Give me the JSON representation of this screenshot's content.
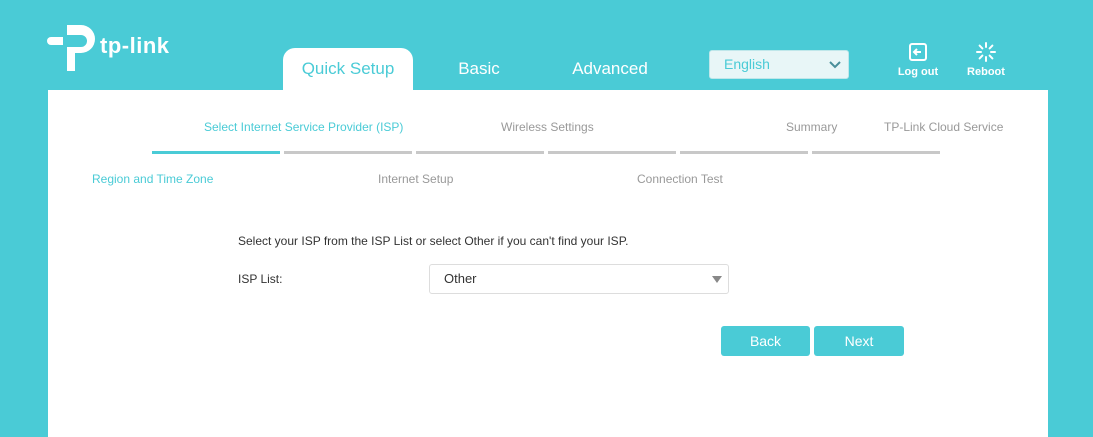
{
  "brand": {
    "name": "tp-link"
  },
  "tabs": [
    {
      "label": "Quick Setup",
      "active": true
    },
    {
      "label": "Basic",
      "active": false
    },
    {
      "label": "Advanced",
      "active": false
    }
  ],
  "language": {
    "selected": "English"
  },
  "header_buttons": {
    "logout": "Log out",
    "reboot": "Reboot"
  },
  "steps_top": [
    {
      "label": "Select Internet Service Provider (ISP)",
      "active": true
    },
    {
      "label": "Wireless Settings",
      "active": false
    },
    {
      "label": "Summary",
      "active": false
    },
    {
      "label": "TP-Link Cloud Service",
      "active": false
    }
  ],
  "steps_bottom": [
    {
      "label": "Region and Time Zone",
      "active": true
    },
    {
      "label": "Internet Setup",
      "active": false
    },
    {
      "label": "Connection Test",
      "active": false
    }
  ],
  "progress": {
    "completed_segments": 1,
    "total_segments": 6
  },
  "form": {
    "description": "Select your ISP from the ISP List or select Other if you can't find your ISP.",
    "isp_label": "ISP List:",
    "isp_value": "Other"
  },
  "buttons": {
    "back": "Back",
    "next": "Next"
  },
  "colors": {
    "accent": "#4acbd6",
    "inactive_text": "#999999",
    "inactive_bar": "#c8c8c8"
  },
  "icons": {
    "logo": "tp-link-logo-icon",
    "logout": "logout-icon",
    "reboot": "reboot-icon",
    "dropdown": "chevron-down-icon"
  }
}
